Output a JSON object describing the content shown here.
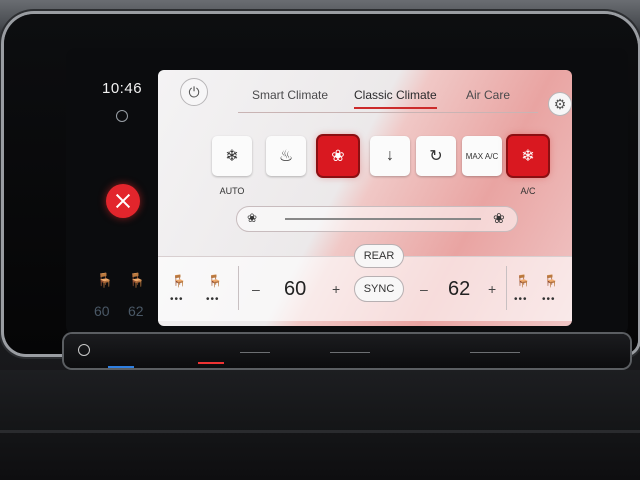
{
  "status": {
    "clock": "10:46",
    "left_temps": [
      "60",
      "62"
    ]
  },
  "tabs": [
    {
      "label": "Smart Climate",
      "active": false
    },
    {
      "label": "Classic Climate",
      "active": true
    },
    {
      "label": "Air Care",
      "active": false
    }
  ],
  "climate_buttons": [
    {
      "name": "auto",
      "label": "AUTO",
      "icon": "fan-icon",
      "active": false
    },
    {
      "name": "rear-defrost",
      "label": "",
      "icon": "rear-defrost-icon",
      "active": false
    },
    {
      "name": "seat-heat-air",
      "label": "",
      "icon": "seat-airflow-icon",
      "active": true
    },
    {
      "name": "footwell-air",
      "label": "",
      "icon": "footwell-airflow-icon",
      "active": false
    },
    {
      "name": "recirculation",
      "label": "",
      "icon": "recirculation-icon",
      "active": false
    },
    {
      "name": "max-ac",
      "label": "",
      "icon": "max-ac-icon",
      "text": "MAX A/C",
      "active": false
    },
    {
      "name": "ac",
      "label": "A/C",
      "icon": "snowflake-icon",
      "active": true
    }
  ],
  "bottom": {
    "rear_label": "REAR",
    "sync_label": "SYNC",
    "driver_temp": "60",
    "passenger_temp": "62",
    "minus": "–",
    "plus": "+"
  },
  "colors": {
    "accent_red": "#d91820",
    "seat_cool_blue": "#3a8fd6"
  }
}
